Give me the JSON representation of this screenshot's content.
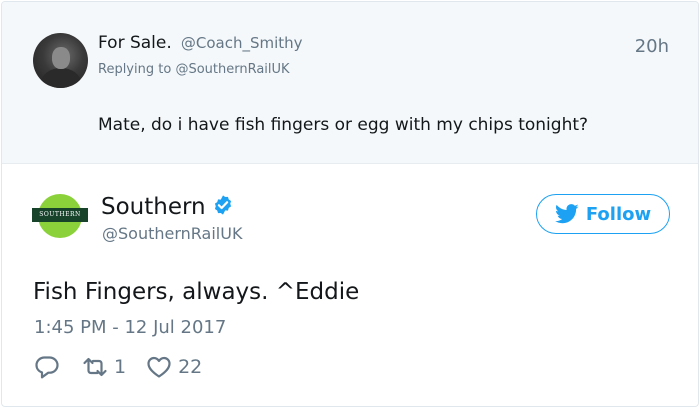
{
  "reply_tweet": {
    "display_name": "For Sale.",
    "handle": "@Coach_Smithy",
    "time": "20h",
    "replying_prefix": "Replying to",
    "replying_to": "@SouthernRailUK",
    "text": "Mate, do i have fish fingers or egg with my chips tonight?"
  },
  "main_tweet": {
    "logo_text": "SOUTHERN",
    "display_name": "Southern",
    "verified": true,
    "handle": "@SouthernRailUK",
    "follow_label": "Follow",
    "text": "Fish Fingers, always. ^Eddie",
    "timestamp": "1:45 PM - 12 Jul 2017",
    "retweet_count": "1",
    "like_count": "22"
  },
  "colors": {
    "accent": "#1da1f2",
    "muted": "#657786",
    "reply_bg": "#f5f8fa",
    "logo_green": "#8bd13a",
    "logo_dark": "#17432b"
  },
  "icons": [
    "avatar",
    "southern-logo",
    "verified-badge-icon",
    "twitter-bird-icon",
    "reply-icon",
    "retweet-icon",
    "heart-icon"
  ]
}
